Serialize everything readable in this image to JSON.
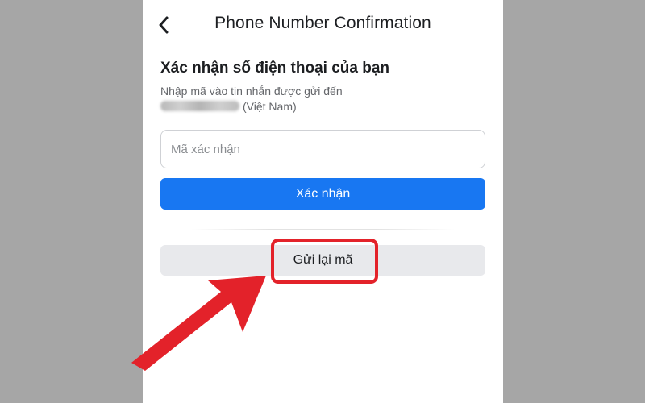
{
  "screen": {
    "title": "Phone Number Confirmation",
    "back_icon": "chevron-left-icon"
  },
  "content": {
    "heading": "Xác nhận số điện thoại của bạn",
    "instruction": "Nhập mã vào tin nhắn được gửi đến",
    "country": "(Việt Nam)"
  },
  "form": {
    "code_placeholder": "Mã xác nhận",
    "code_value": "",
    "confirm_label": "Xác nhận",
    "resend_label": "Gửi lại mã"
  },
  "annotation": {
    "color": "#e3222a",
    "highlight_target": "resend-code-button",
    "arrow_icon": "arrow-pointer-icon"
  },
  "colors": {
    "primary": "#1877f2",
    "secondary_button_bg": "#e8e9ec",
    "page_backdrop": "#a6a6a6"
  }
}
